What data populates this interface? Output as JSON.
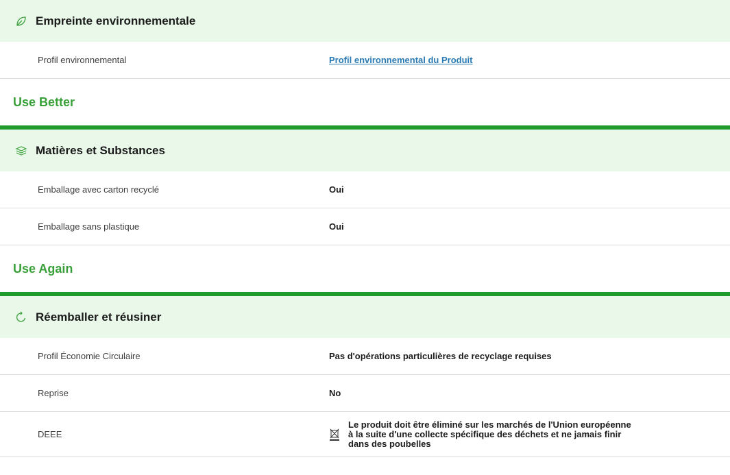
{
  "sections": {
    "env": {
      "icon": "leaf-icon",
      "title": "Empreinte environnementale",
      "rows": [
        {
          "label": "Profil environnemental",
          "value": "Profil environnemental du Produit"
        }
      ]
    },
    "use_better": {
      "group": "Use Better",
      "icon": "layers-icon",
      "title": "Matières et Substances",
      "rows": [
        {
          "label": "Emballage avec carton recyclé",
          "value": "Oui"
        },
        {
          "label": "Emballage sans plastique",
          "value": "Oui"
        }
      ]
    },
    "use_again": {
      "group": "Use Again",
      "icon": "refresh-icon",
      "title": "Réemballer et réusiner",
      "rows": [
        {
          "label": "Profil Économie Circulaire",
          "value": "Pas d'opérations particulières de recyclage requises"
        },
        {
          "label": "Reprise",
          "value": "No"
        },
        {
          "label": "DEEE",
          "value": "Le produit doit être éliminé sur les marchés de l'Union européenne à la suite d'une collecte spécifique des déchets et ne jamais finir dans des poubelles",
          "icon": "weee-bin-icon"
        }
      ]
    }
  },
  "colors": {
    "accent_green": "#3aa13a",
    "divider_green": "#1f9a2f",
    "section_bg": "#eaf8ea",
    "link": "#2a7ab3"
  }
}
